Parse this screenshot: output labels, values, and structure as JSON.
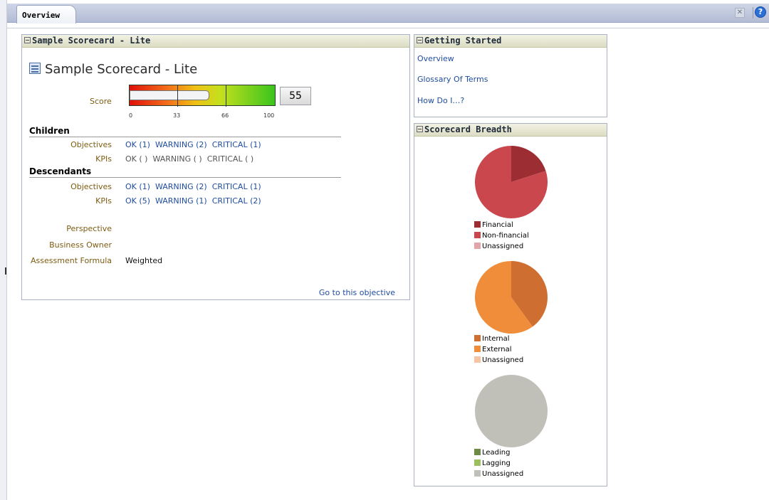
{
  "tabs": {
    "active": "Overview"
  },
  "scorecard_panel": {
    "header": "Sample Scorecard - Lite",
    "title": "Sample Scorecard - Lite",
    "score_label": "Score",
    "score_value": "55",
    "score": 55,
    "gauge_ticks": [
      "0",
      "33",
      "66",
      "100"
    ],
    "children_heading": "Children",
    "descendants_heading": "Descendants",
    "children": {
      "objectives": {
        "label": "Objectives",
        "ok": "OK (1)",
        "warning": "WARNING (2)",
        "critical": "CRITICAL (1)"
      },
      "kpis": {
        "label": "KPIs",
        "ok": "OK ( )",
        "warning": "WARNING ( )",
        "critical": "CRITICAL ( )"
      }
    },
    "descendants": {
      "objectives": {
        "label": "Objectives",
        "ok": "OK (1)",
        "warning": "WARNING (2)",
        "critical": "CRITICAL (1)"
      },
      "kpis": {
        "label": "KPIs",
        "ok": "OK (5)",
        "warning": "WARNING (1)",
        "critical": "CRITICAL (2)"
      }
    },
    "details": {
      "perspective_label": "Perspective",
      "perspective_value": "",
      "owner_label": "Business Owner",
      "owner_value": "",
      "formula_label": "Assessment Formula",
      "formula_value": "Weighted"
    },
    "goto_link": "Go to this objective"
  },
  "getting_started": {
    "header": "Getting Started",
    "links": [
      "Overview",
      "Glossary Of Terms",
      "How Do I…?"
    ]
  },
  "breadth": {
    "header": "Scorecard Breadth",
    "pies": [
      {
        "legend": [
          "Financial",
          "Non-financial",
          "Unassigned"
        ],
        "colors": [
          "#9b2d33",
          "#c9474d",
          "#e2a6aa"
        ],
        "shares": [
          0.2,
          0.8,
          0
        ]
      },
      {
        "legend": [
          "Internal",
          "External",
          "Unassigned"
        ],
        "colors": [
          "#cf6e31",
          "#ef8d3a",
          "#f7c4a3"
        ],
        "shares": [
          0.4,
          0.6,
          0
        ]
      },
      {
        "legend": [
          "Leading",
          "Lagging",
          "Unassigned"
        ],
        "colors": [
          "#6e8c45",
          "#9bc05d",
          "#c0bfb8"
        ],
        "shares": [
          0,
          0,
          1
        ]
      }
    ]
  },
  "colors": {
    "link": "#1f4c9f",
    "label": "#7d5c12"
  }
}
